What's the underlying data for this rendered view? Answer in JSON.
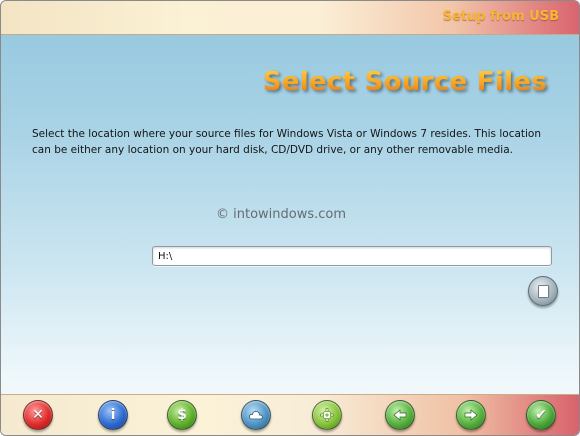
{
  "window": {
    "title": "Setup from USB"
  },
  "main": {
    "heading": "Select Source Files",
    "description": "Select the location where your source files for Windows Vista or Windows 7 resides. This location can be either any location on your hard disk, CD/DVD drive, or any other removable media.",
    "watermark": "© intowindows.com",
    "source_path": {
      "value": "H:\\",
      "placeholder": ""
    },
    "browse_icon": "document-icon"
  },
  "footer": {
    "buttons": [
      {
        "icon": "close-icon",
        "glyph": "✕",
        "color": "#e02b2b"
      },
      {
        "icon": "info-icon",
        "glyph": "i",
        "color": "#2c6ad2"
      },
      {
        "icon": "dollar-icon",
        "glyph": "$",
        "color": "#5fb02a"
      },
      {
        "icon": "cloud-icon",
        "glyph": "",
        "color": "#4f93c4"
      },
      {
        "icon": "gear-icon",
        "glyph": "",
        "color": "#86c23a"
      },
      {
        "icon": "back-arrow-icon",
        "glyph": "",
        "color": "#54b03c"
      },
      {
        "icon": "forward-arrow-icon",
        "glyph": "",
        "color": "#54b03c"
      },
      {
        "icon": "checkmark-icon",
        "glyph": "✔",
        "color": "#4aa838"
      }
    ]
  }
}
